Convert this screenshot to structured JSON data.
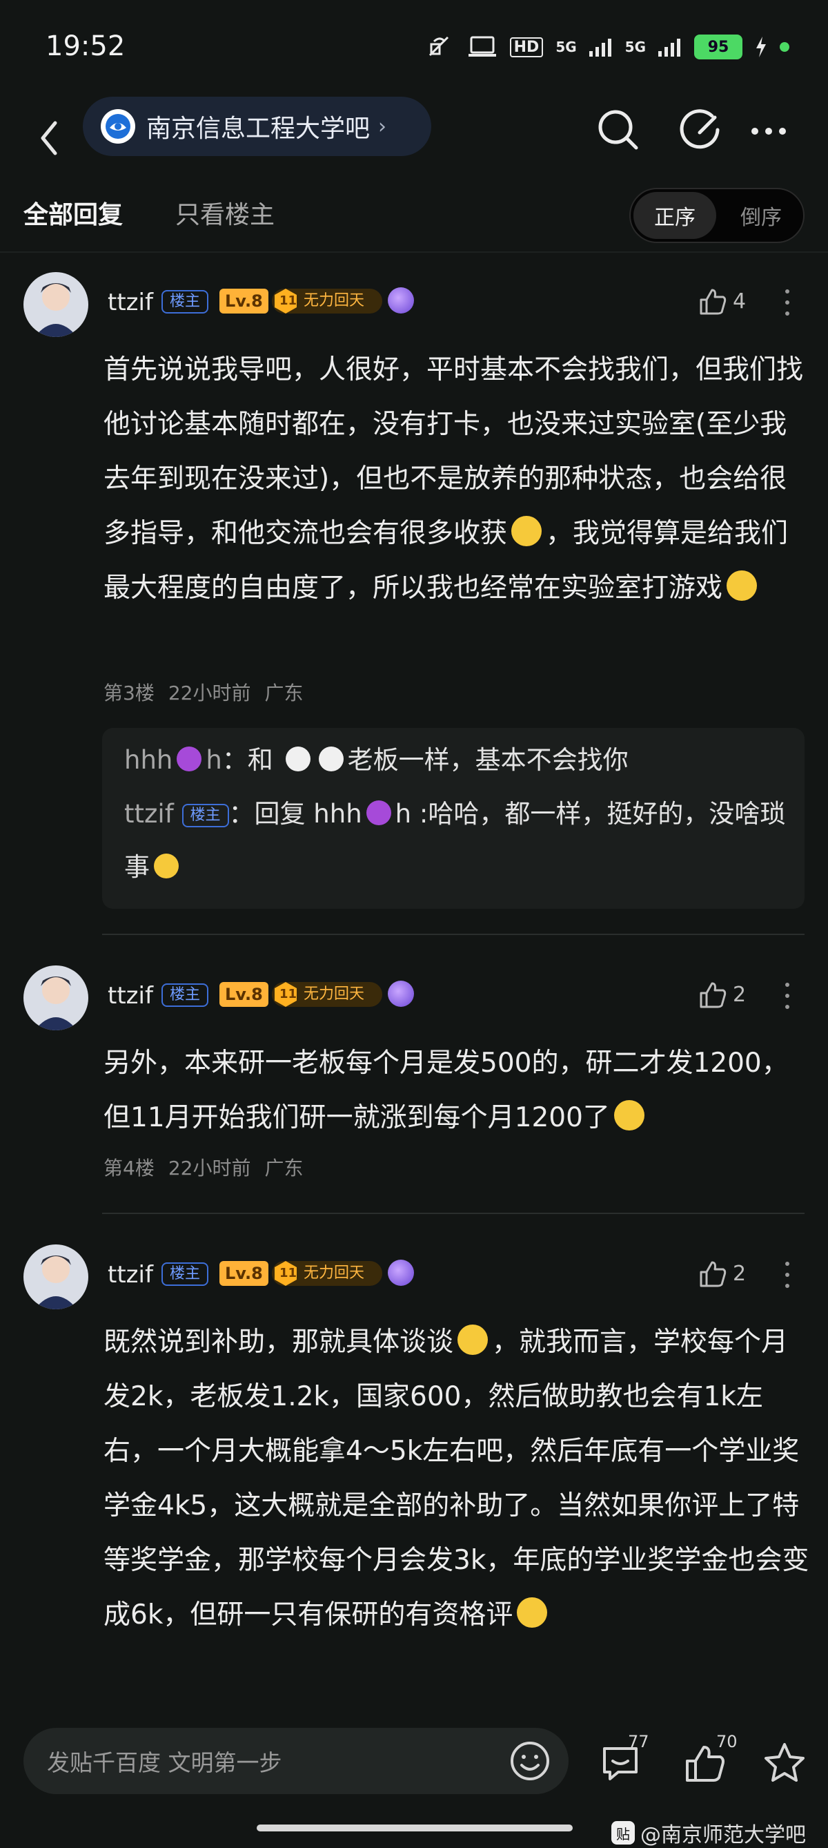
{
  "status": {
    "time": "19:52",
    "battery": "95",
    "network1": "5G",
    "network2": "5G",
    "hd": "HD"
  },
  "header": {
    "forum_name": "南京信息工程大学吧"
  },
  "tabs": {
    "all": "全部回复",
    "owner_only": "只看楼主"
  },
  "sort": {
    "asc": "正序",
    "desc": "倒序"
  },
  "badges": {
    "owner": "楼主",
    "level": "Lv.8",
    "honor_num": "11",
    "honor": "无力回天"
  },
  "posts": [
    {
      "user": "ttzif",
      "likes": "4",
      "text": "首先说说我导吧，人很好，平时基本不会找我们，但我们找他讨论基本随时都在，没有打卡，也没来过实验室(至少我去年到现在没来过)，但也不是放养的那种状态，也会给很多指导，和他交流也会有很多收获",
      "text2": "，我觉得算是给我们最大程度的自由度了，所以我也经常在实验室打游戏",
      "floor": "第3楼",
      "time": "22小时前",
      "location": "广东",
      "replies": [
        {
          "name": "hhh",
          "name_suffix": "h",
          "text": "：和",
          "text2": "老板一样，基本不会找你"
        },
        {
          "name": "ttzif",
          "badge": "楼主",
          "prefix": "：回复 hhh",
          "suffix": "h :哈哈，都一样，挺好的，没啥琐事"
        }
      ]
    },
    {
      "user": "ttzif",
      "likes": "2",
      "text": "另外，本来研一老板每个月是发500的，研二才发1200，但11月开始我们研一就涨到每个月1200了",
      "floor": "第4楼",
      "time": "22小时前",
      "location": "广东"
    },
    {
      "user": "ttzif",
      "likes": "2",
      "text": "既然说到补助，那就具体谈谈",
      "text2": "，就我而言，学校每个月发2k，老板发1.2k，国家600，然后做助教也会有1k左右，一个月大概能拿4～5k左右吧，然后年底有一个学业奖学金4k5，这大概就是全部的补助了。当然如果你评上了特等奖学金，那学校每个月会发3k，年底的学业奖学金也会变成6k，但研一只有保研的有资格评"
    }
  ],
  "bottom": {
    "input_placeholder": "发贴千百度 文明第一步",
    "comments": "77",
    "likes": "70",
    "watermark": "@南京师范大学吧",
    "wm_logo": "贴"
  }
}
